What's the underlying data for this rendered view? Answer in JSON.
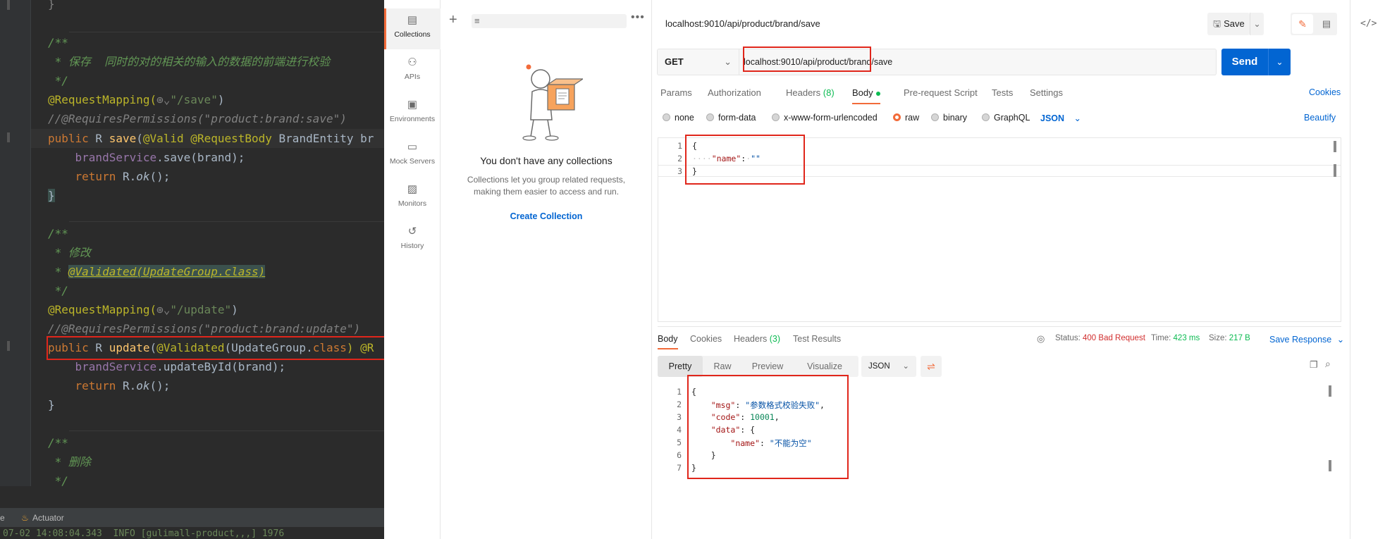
{
  "ide": {
    "code_lines": [
      {
        "key": "close_brace_1",
        "text": "}"
      },
      {
        "key": "doc_open_1",
        "text": "/**"
      },
      {
        "key": "doc_save",
        "text": " * 保存  同时的对的相关的输入的数据的前端进行校验"
      },
      {
        "key": "doc_close_1",
        "text": " */"
      },
      {
        "key": "req_mapping_save",
        "prefix": "@RequestMapping(",
        "path": "\"/save\"",
        "suffix": ")"
      },
      {
        "key": "req_perm_save",
        "text": "//@RequiresPermissions(\"product:brand:save\")"
      },
      {
        "key": "method_save",
        "kw": "public",
        "type": " R ",
        "fn": "save",
        "rest_a": "(",
        "anno": "@Valid @RequestBody",
        "rest_b": " BrandEntity br"
      },
      {
        "key": "call_save",
        "obj": "brandService",
        "call": ".save(brand);"
      },
      {
        "key": "return_1",
        "kw": "return",
        "rest": " R.",
        "method": "ok",
        "tail": "();"
      },
      {
        "key": "close_brace_2",
        "text": "}"
      },
      {
        "key": "doc_open_2",
        "text": "/**"
      },
      {
        "key": "doc_update",
        "text": " * 修改"
      },
      {
        "key": "doc_validated",
        "prefix": " * ",
        "text": "@Validated(UpdateGroup.class)"
      },
      {
        "key": "doc_close_2",
        "text": " */"
      },
      {
        "key": "req_mapping_update",
        "prefix": "@RequestMapping(",
        "path": "\"/update\"",
        "suffix": ")"
      },
      {
        "key": "req_perm_update",
        "text": "//@RequiresPermissions(\"product:brand:update\")"
      },
      {
        "key": "method_update",
        "kw": "public",
        "type": " R ",
        "fn": "update",
        "rest_a": "(",
        "anno": "@Validated",
        "rest_b": "(UpdateGroup.",
        "kw2": "class",
        "rest_c": ") @R"
      },
      {
        "key": "call_update",
        "obj": "brandService",
        "call": ".updateById(brand);"
      },
      {
        "key": "return_2",
        "kw": "return",
        "rest": " R.",
        "method": "ok",
        "tail": "();"
      },
      {
        "key": "close_brace_3",
        "text": "}"
      },
      {
        "key": "doc_open_3",
        "text": "/**"
      },
      {
        "key": "doc_delete",
        "text": " * 删除"
      },
      {
        "key": "doc_close_3",
        "text": " */"
      }
    ],
    "bottom_tab": "Actuator",
    "bottom_left": "e",
    "console_text": "07-02 14:08:04.343  INFO [gulimall-product,,,] 1976"
  },
  "rail": {
    "items": [
      {
        "label": "Collections"
      },
      {
        "label": "APIs"
      },
      {
        "label": "Environments"
      },
      {
        "label": "Mock Servers"
      },
      {
        "label": "Monitors"
      },
      {
        "label": "History"
      }
    ]
  },
  "collections": {
    "empty_title": "You don't have any collections",
    "empty_desc": "Collections let you group related requests, making them easier to access and run.",
    "create_label": "Create Collection"
  },
  "request": {
    "tab_title": "localhost:9010/api/product/brand/save",
    "save_label": "Save",
    "method": "GET",
    "url": "localhost:9010/api/product/brand/save",
    "send_label": "Send",
    "tabs": {
      "params": "Params",
      "authorization": "Authorization",
      "headers": "Headers",
      "headers_count": "(8)",
      "body": "Body",
      "prerequest": "Pre-request Script",
      "tests": "Tests",
      "settings": "Settings"
    },
    "cookies_label": "Cookies",
    "body_types": {
      "none": "none",
      "form_data": "form-data",
      "urlencoded": "x-www-form-urlencoded",
      "raw": "raw",
      "binary": "binary",
      "graphql": "GraphQL"
    },
    "raw_format": "JSON",
    "beautify_label": "Beautify",
    "body_lines": [
      {
        "num": "1",
        "text": "{"
      },
      {
        "num": "2",
        "key": "\"name\"",
        "sep": ":",
        "val": "\"\""
      },
      {
        "num": "3",
        "text": "}"
      }
    ]
  },
  "response": {
    "tabs": {
      "body": "Body",
      "cookies": "Cookies",
      "headers": "Headers",
      "headers_count": "(3)",
      "test_results": "Test Results"
    },
    "status_label": "Status:",
    "status_value": "400 Bad Request",
    "time_label": "Time:",
    "time_value": "423 ms",
    "size_label": "Size:",
    "size_value": "217 B",
    "save_response_label": "Save Response",
    "views": {
      "pretty": "Pretty",
      "raw": "Raw",
      "preview": "Preview",
      "visualize": "Visualize"
    },
    "format": "JSON",
    "body_lines": [
      {
        "num": "1",
        "text": "{"
      },
      {
        "num": "2",
        "indent": "    ",
        "key": "\"msg\"",
        "val": "\"参数格式校验失败\"",
        "tail": ","
      },
      {
        "num": "3",
        "indent": "    ",
        "key": "\"code\"",
        "num_val": "10001",
        "tail": ","
      },
      {
        "num": "4",
        "indent": "    ",
        "key": "\"data\"",
        "tail": "{"
      },
      {
        "num": "5",
        "indent": "        ",
        "key": "\"name\"",
        "val": "\"不能为空\""
      },
      {
        "num": "6",
        "text": "    }"
      },
      {
        "num": "7",
        "text": "}"
      }
    ]
  },
  "colors": {
    "accent": "#f26b3a",
    "primary": "#0265d2",
    "error_box": "#e0261b",
    "ide_bg": "#2b2b2b"
  }
}
